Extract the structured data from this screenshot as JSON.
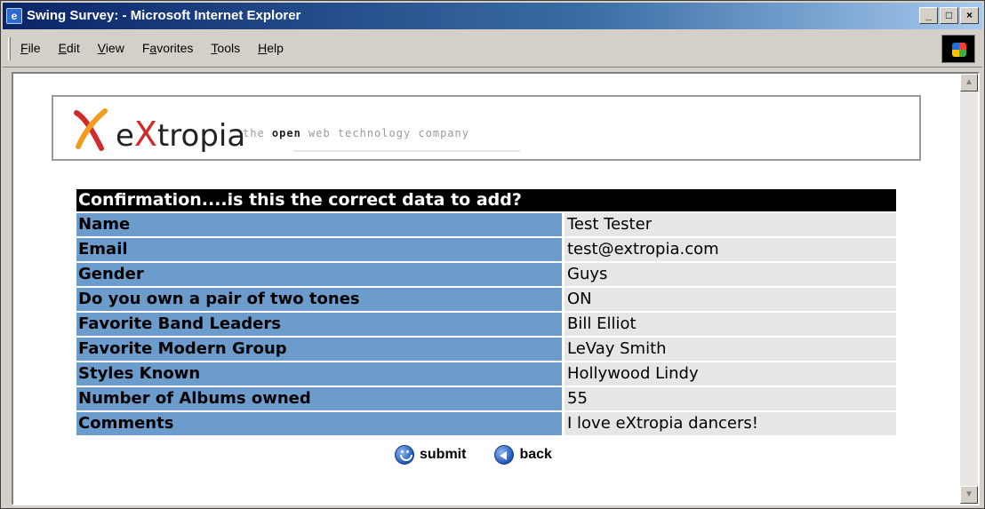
{
  "window": {
    "title": "Swing Survey: - Microsoft Internet Explorer",
    "controls": [
      "_",
      "□",
      "×"
    ]
  },
  "menu": {
    "items": [
      {
        "label": "File",
        "accel": "F"
      },
      {
        "label": "Edit",
        "accel": "E"
      },
      {
        "label": "View",
        "accel": "V"
      },
      {
        "label": "Favorites",
        "accel": "a"
      },
      {
        "label": "Tools",
        "accel": "T"
      },
      {
        "label": "Help",
        "accel": "H"
      }
    ]
  },
  "logo": {
    "word_prefix": "e",
    "word_x": "X",
    "word_rest": "tropia",
    "tag_pre": "the ",
    "tag_bold": "open",
    "tag_post": " web technology company"
  },
  "confirmation": {
    "header": "Confirmation....is this the correct data to add?",
    "rows": [
      {
        "label": "Name",
        "value": "Test Tester"
      },
      {
        "label": "Email",
        "value": "test@extropia.com"
      },
      {
        "label": "Gender",
        "value": "Guys"
      },
      {
        "label": "Do you own a pair of two tones",
        "value": "ON"
      },
      {
        "label": "Favorite Band Leaders",
        "value": "Bill Elliot"
      },
      {
        "label": "Favorite Modern Group",
        "value": "LeVay Smith"
      },
      {
        "label": "Styles Known",
        "value": "Hollywood Lindy"
      },
      {
        "label": "Number of Albums owned",
        "value": "55"
      },
      {
        "label": "Comments",
        "value": "I love eXtropia dancers!"
      }
    ]
  },
  "actions": {
    "submit_label": "submit",
    "back_label": "back"
  },
  "colors": {
    "label_bg": "#6c9ccc",
    "value_bg": "#e6e6e6",
    "header_bg": "#000000",
    "titlebar": "#0a246a"
  }
}
